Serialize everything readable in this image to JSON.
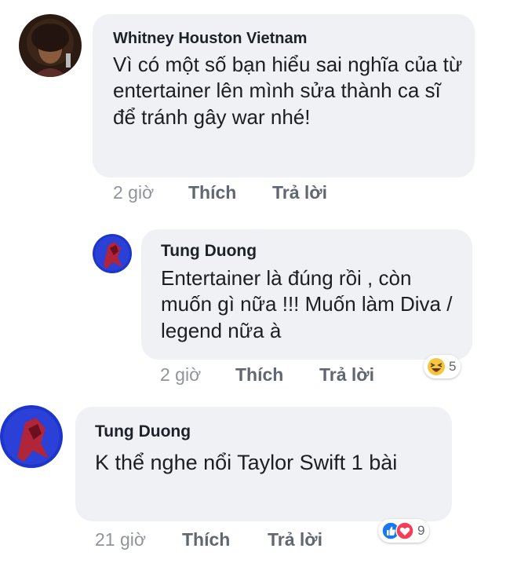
{
  "comments": [
    {
      "author": "Whitney Houston Vietnam",
      "text": "Vì có một số bạn hiểu sai nghĩa của từ entertainer lên mình sửa thành ca sĩ để tránh gây war nhé!",
      "time": "2 giờ",
      "like_label": "Thích",
      "reply_label": "Trả lời"
    },
    {
      "author": "Tung Duong",
      "text": "Entertainer là đúng rồi , còn muốn gì nữa !!! Muốn làm Diva / legend nữa à",
      "time": "2 giờ",
      "like_label": "Thích",
      "reply_label": "Trả lời",
      "reactions": {
        "icons": [
          "haha-icon"
        ],
        "count": "5"
      }
    },
    {
      "author": "Tung Duong",
      "text": "K thể nghe nổi Taylor Swift 1 bài",
      "time": "21 giờ",
      "like_label": "Thích",
      "reply_label": "Trả lời",
      "reactions": {
        "icons": [
          "like-icon",
          "love-icon"
        ],
        "count": "9"
      }
    }
  ],
  "colors": {
    "bubble": "#f0f1f4",
    "like_blue": "#1877f2",
    "love_red": "#f33e58",
    "haha_yellow": "#f7c640"
  }
}
